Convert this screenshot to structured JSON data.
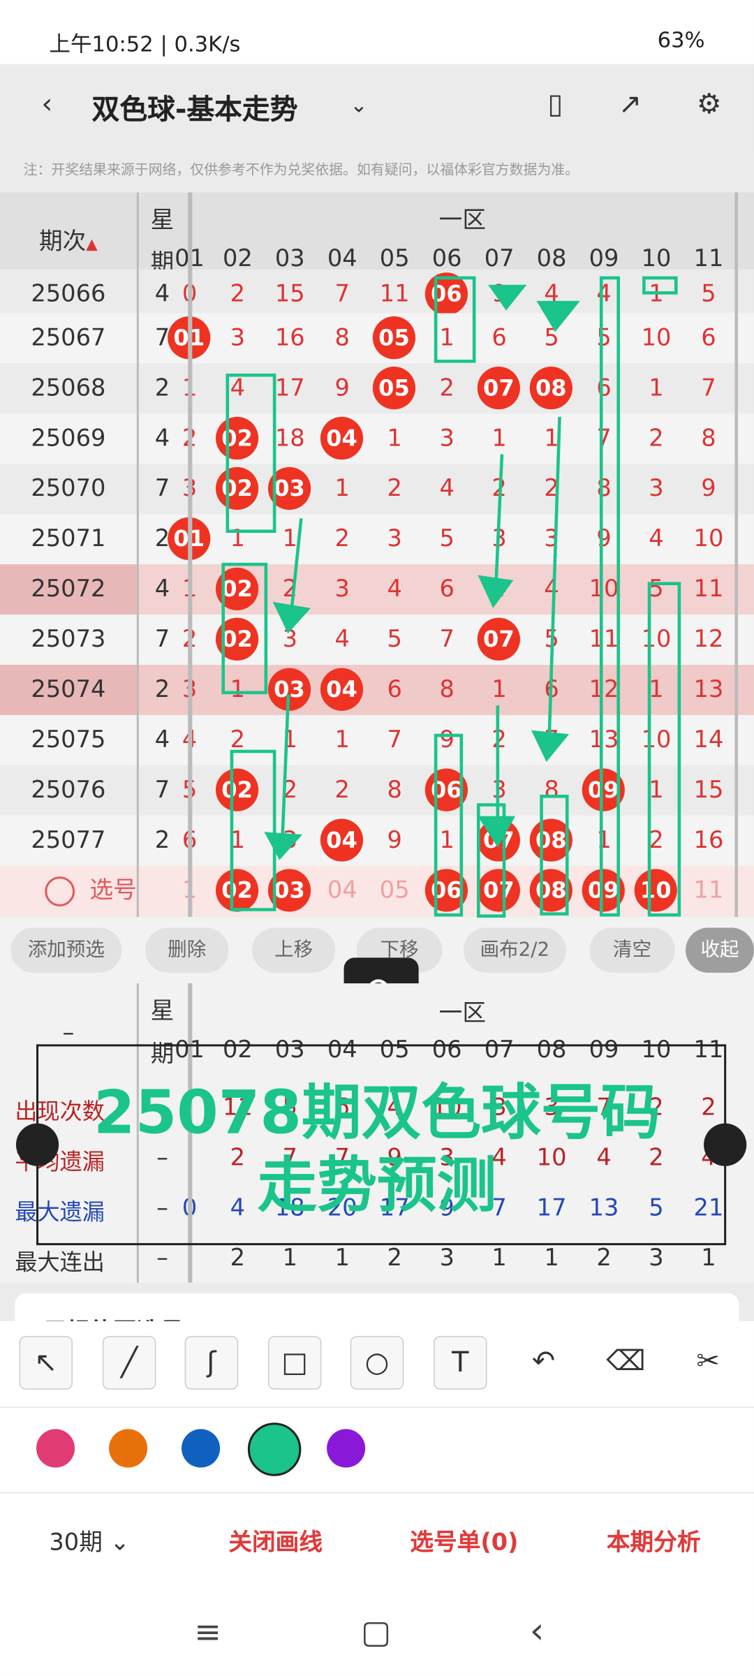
{
  "status": {
    "time": "上午10:52 | 0.3K/s",
    "battery": "63%"
  },
  "appbar": {
    "title": "双色球-基本走势",
    "back": "back-icon",
    "dropdown": "chevron-down-icon"
  },
  "note": "注：开奖结果来源于网络，仅供参考不作为兑奖依据。如有疑问，以福体彩官方数据为准。",
  "header": {
    "issue": "期次",
    "week_top": "星",
    "week_bottom": "期",
    "zone": "一区",
    "cols": [
      "01",
      "02",
      "03",
      "04",
      "05",
      "06",
      "07",
      "08",
      "09",
      "10",
      "11"
    ]
  },
  "rows": [
    {
      "issue": "25066",
      "week": "4",
      "vals": [
        "0",
        "2",
        "15",
        "7",
        "11",
        "06",
        "9",
        "4",
        "4",
        "1",
        "5"
      ]
    },
    {
      "issue": "25067",
      "week": "7",
      "vals": [
        "01",
        "3",
        "16",
        "8",
        "05",
        "1",
        "6",
        "5",
        "5",
        "10",
        "6"
      ]
    },
    {
      "issue": "25068",
      "week": "2",
      "vals": [
        "1",
        "4",
        "17",
        "9",
        "05",
        "2",
        "07",
        "08",
        "6",
        "1",
        "7"
      ]
    },
    {
      "issue": "25069",
      "week": "4",
      "vals": [
        "2",
        "02",
        "18",
        "04",
        "1",
        "3",
        "1",
        "1",
        "7",
        "2",
        "8"
      ]
    },
    {
      "issue": "25070",
      "week": "7",
      "vals": [
        "3",
        "02",
        "03",
        "1",
        "2",
        "4",
        "2",
        "2",
        "8",
        "3",
        "9"
      ]
    },
    {
      "issue": "25071",
      "week": "2",
      "vals": [
        "01",
        "1",
        "1",
        "2",
        "3",
        "5",
        "3",
        "3",
        "9",
        "4",
        "10"
      ]
    },
    {
      "issue": "25072",
      "week": "4",
      "vals": [
        "1",
        "02",
        "2",
        "3",
        "4",
        "6",
        "4",
        "4",
        "10",
        "5",
        "11"
      ]
    },
    {
      "issue": "25073",
      "week": "7",
      "vals": [
        "2",
        "02",
        "3",
        "4",
        "5",
        "7",
        "07",
        "5",
        "11",
        "10",
        "12"
      ]
    },
    {
      "issue": "25074",
      "week": "2",
      "vals": [
        "3",
        "1",
        "03",
        "04",
        "6",
        "8",
        "1",
        "6",
        "12",
        "1",
        "13"
      ]
    },
    {
      "issue": "25075",
      "week": "4",
      "vals": [
        "4",
        "2",
        "1",
        "1",
        "7",
        "9",
        "2",
        "7",
        "13",
        "10",
        "14"
      ]
    },
    {
      "issue": "25076",
      "week": "7",
      "vals": [
        "5",
        "02",
        "2",
        "2",
        "8",
        "06",
        "3",
        "8",
        "09",
        "1",
        "15"
      ]
    },
    {
      "issue": "25077",
      "week": "2",
      "vals": [
        "6",
        "1",
        "3",
        "04",
        "9",
        "1",
        "07",
        "08",
        "1",
        "2",
        "16"
      ]
    }
  ],
  "select_row": {
    "label": "选号",
    "vals": [
      "1",
      "02",
      "03",
      "04",
      "05",
      "06",
      "07",
      "08",
      "09",
      "10",
      "11"
    ]
  },
  "toolbar": {
    "chips": [
      "添加预选",
      "删除",
      "上移",
      "下移",
      "画布2/2",
      "清空",
      "收起"
    ]
  },
  "stats": {
    "zone": "一区",
    "rows": [
      {
        "label": "出现次数",
        "dash": "–",
        "vals": [
          "",
          "11",
          "5",
          "6",
          "4",
          "10",
          "3",
          "3",
          "7",
          "2",
          "2"
        ]
      },
      {
        "label": "平均遗漏",
        "dash": "–",
        "vals": [
          "",
          "2",
          "7",
          "7",
          "9",
          "3",
          "4",
          "10",
          "4",
          "2",
          "4"
        ]
      },
      {
        "label": "最大遗漏",
        "dash": "–",
        "vals": [
          "0",
          "4",
          "18",
          "20",
          "17",
          "9",
          "7",
          "17",
          "13",
          "5",
          "21"
        ]
      },
      {
        "label": "最大连出",
        "dash": "–",
        "vals": [
          "",
          "2",
          "1",
          "1",
          "2",
          "3",
          "1",
          "1",
          "2",
          "3",
          "1"
        ]
      }
    ]
  },
  "watermark": {
    "line1": "25078期双色球号码",
    "line2": "走势预测"
  },
  "section_preview": "用规律图选号",
  "bottom": {
    "period": "30期",
    "close": "关闭画线",
    "selection": "选号单(0)",
    "analysis": "本期分析"
  }
}
